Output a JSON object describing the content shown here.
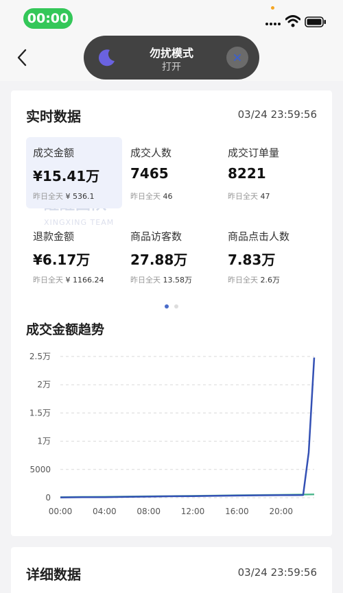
{
  "status_bar": {
    "time": "00:00"
  },
  "dnd": {
    "title": "勿扰模式",
    "subtitle": "打开"
  },
  "realtime": {
    "title": "实时数据",
    "timestamp": "03/24 23:59:56",
    "metrics": [
      {
        "label": "成交金额",
        "value": "¥15.41万",
        "compare_label": "昨日全天",
        "compare_value": "¥ 536.1"
      },
      {
        "label": "成交人数",
        "value": "7465",
        "compare_label": "昨日全天",
        "compare_value": "46"
      },
      {
        "label": "成交订单量",
        "value": "8221",
        "compare_label": "昨日全天",
        "compare_value": "47"
      },
      {
        "label": "退款金额",
        "value": "¥6.17万",
        "compare_label": "昨日全天",
        "compare_value": "¥ 1166.24"
      },
      {
        "label": "商品访客数",
        "value": "27.88万",
        "compare_label": "昨日全天",
        "compare_value": "13.58万"
      },
      {
        "label": "商品点击人数",
        "value": "7.83万",
        "compare_label": "昨日全天",
        "compare_value": "2.6万"
      }
    ],
    "watermark": {
      "line1": "醒醒团队",
      "line2": "XINGXING TEAM"
    }
  },
  "trend": {
    "title": "成交金额趋势"
  },
  "chart_data": {
    "type": "line",
    "title": "成交金额趋势",
    "xlabel": "",
    "ylabel": "",
    "x_tick_labels": [
      "00:00",
      "04:00",
      "08:00",
      "12:00",
      "16:00",
      "20:00"
    ],
    "y_tick_labels": [
      "0",
      "5000",
      "1万",
      "1.5万",
      "2万",
      "2.5万"
    ],
    "y_tick_values": [
      0,
      5000,
      10000,
      15000,
      20000,
      25000
    ],
    "xlim": [
      0,
      23
    ],
    "ylim": [
      0,
      25000
    ],
    "grid": true,
    "series": [
      {
        "color": "#3350b4",
        "x": [
          0,
          2,
          4,
          6,
          8,
          10,
          12,
          14,
          16,
          18,
          20,
          21,
          22.0,
          22.5,
          23
        ],
        "y": [
          50,
          80,
          100,
          150,
          200,
          250,
          280,
          330,
          380,
          420,
          450,
          460,
          470,
          8000,
          24800
        ]
      },
      {
        "color": "#52b990",
        "x": [
          0,
          2,
          4,
          6,
          8,
          10,
          12,
          14,
          16,
          18,
          20,
          22,
          23
        ],
        "y": [
          100,
          130,
          160,
          200,
          240,
          280,
          320,
          370,
          420,
          460,
          500,
          560,
          600
        ]
      }
    ]
  },
  "detail": {
    "title": "详细数据",
    "timestamp": "03/24 23:59:56"
  }
}
